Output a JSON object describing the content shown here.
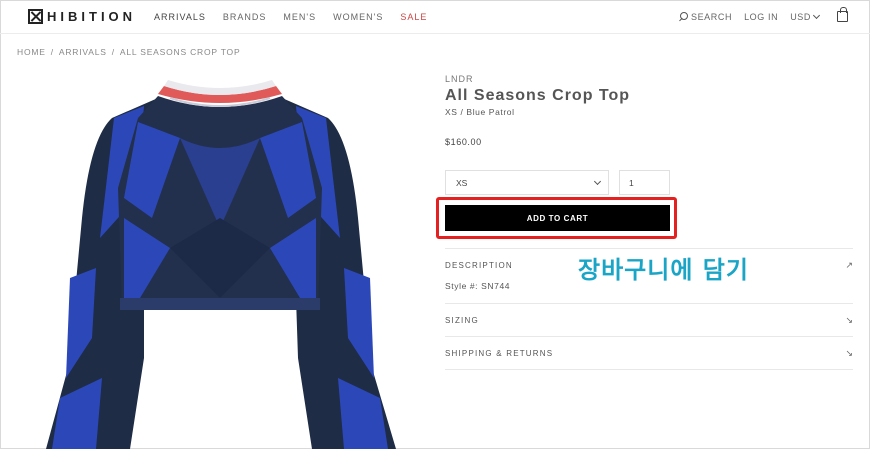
{
  "header": {
    "logo_text": "HIBITION",
    "nav": [
      "ARRIVALS",
      "BRANDS",
      "MEN'S",
      "WOMEN'S",
      "SALE"
    ],
    "search_label": "SEARCH",
    "login_label": "LOG IN",
    "currency": "USD"
  },
  "breadcrumb": [
    "HOME",
    "/",
    "ARRIVALS",
    "/",
    "ALL SEASONS CROP TOP"
  ],
  "product": {
    "brand": "LNDR",
    "title": "All Seasons Crop Top",
    "variant": "XS / Blue Patrol",
    "price": "$160.00",
    "size": "XS",
    "quantity": "1",
    "add_to_cart": "ADD TO CART"
  },
  "accordion": [
    {
      "title": "DESCRIPTION",
      "arrow": "↗",
      "body": "Style #: SN744"
    },
    {
      "title": "SIZING",
      "arrow": "↘"
    },
    {
      "title": "SHIPPING & RETURNS",
      "arrow": "↘"
    }
  ],
  "annotation": "장바구니에 담기",
  "colors": {
    "highlight": "#e52020",
    "annotation": "#1aa5c7",
    "sale": "#cc4444",
    "shirt_navy": "#1e2c46",
    "shirt_blue": "#2c48b8",
    "collar_red": "#e05a5a"
  }
}
